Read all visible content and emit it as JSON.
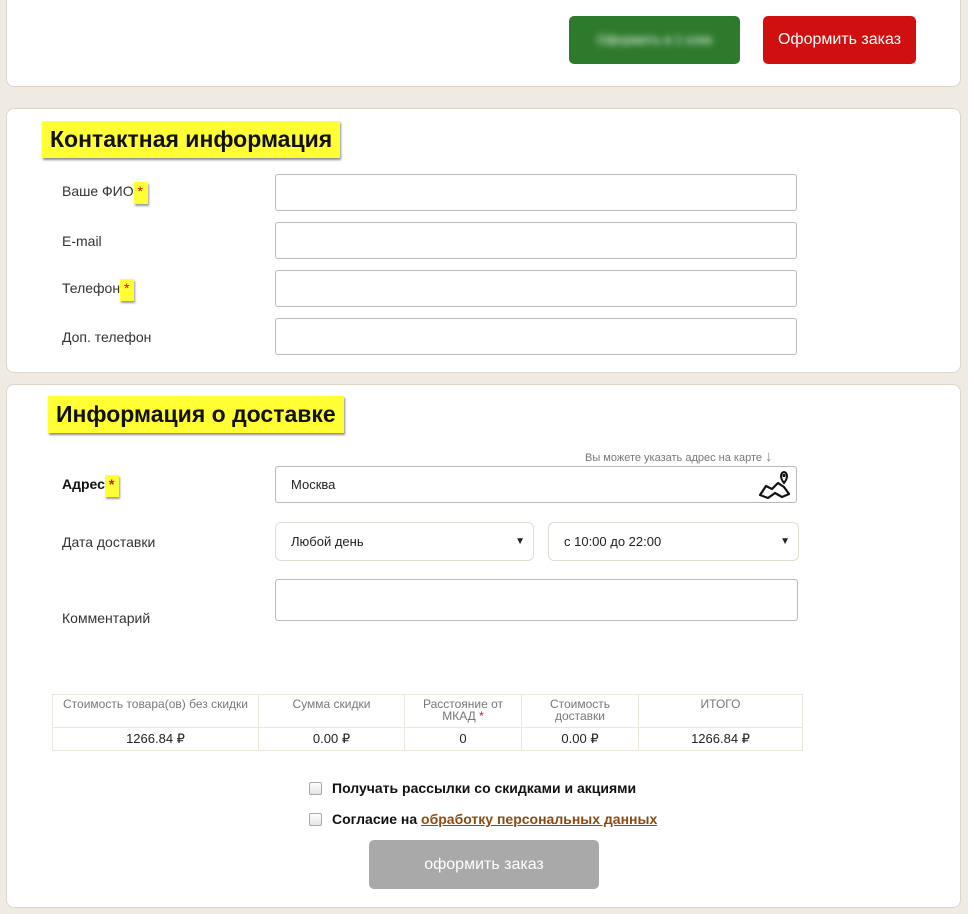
{
  "top": {
    "one_click_label": "Оформить в 1 клик",
    "order_label": "Оформить заказ"
  },
  "contact": {
    "title": "Контактная информация",
    "fields": [
      {
        "label": "Ваше ФИО",
        "required": "*",
        "value": ""
      },
      {
        "label": "E-mail",
        "value": ""
      },
      {
        "label": "Телефон",
        "required": "*",
        "value": ""
      },
      {
        "label": "Доп. телефон",
        "value": ""
      }
    ]
  },
  "delivery": {
    "title": "Информация о доставке",
    "map_hint": "Вы можете указать адрес на карте",
    "map_hint_arrow": "↓",
    "address_label": "Адрес",
    "address_required": "*",
    "address_value": "Москва",
    "date_label": "Дата доставки",
    "date_value": "Любой день",
    "time_value": "с 10:00 до 22:00",
    "select_arrow": "▼",
    "comment_label": "Комментарий",
    "comment_value": ""
  },
  "cost_table": {
    "headers": [
      "Стоимость товара(ов) без скидки",
      "Сумма скидки",
      "Расстояние от МКАД",
      "Стоимость доставки",
      "ИТОГО"
    ],
    "required_mark": "*",
    "values": [
      "1266.84 ₽",
      "0.00 ₽",
      "0",
      "0.00 ₽",
      "1266.84 ₽"
    ]
  },
  "options": {
    "newsletter_label": "Получать рассылки со скидками и акциями",
    "consent_prefix": "Согласие на",
    "consent_link": "обработку персональных данных"
  },
  "submit_label": "оформить заказ",
  "colors": {
    "highlight": "#ffff33",
    "order_red": "#d01010",
    "one_click_green": "#2d7a2d",
    "submit_gray": "#a9a9a9",
    "link_brown": "#8a4a12"
  }
}
